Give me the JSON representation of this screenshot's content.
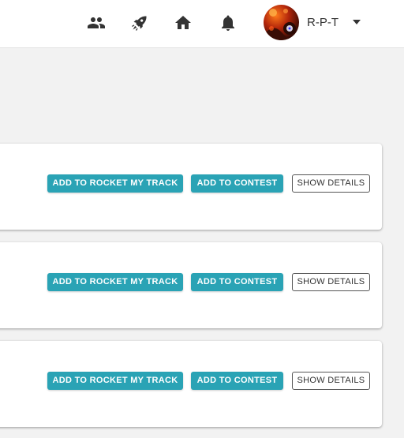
{
  "topbar": {
    "icons": [
      "people-icon",
      "rocket-icon",
      "home-icon",
      "bell-icon"
    ],
    "user": {
      "name": "R-P-T"
    }
  },
  "cards": [
    {
      "rocket_label": "ADD TO ROCKET MY TRACK",
      "contest_label": "ADD TO CONTEST",
      "details_label": "SHOW DETAILS"
    },
    {
      "rocket_label": "ADD TO ROCKET MY TRACK",
      "contest_label": "ADD TO CONTEST",
      "details_label": "SHOW DETAILS"
    },
    {
      "rocket_label": "ADD TO ROCKET MY TRACK",
      "contest_label": "ADD TO CONTEST",
      "details_label": "SHOW DETAILS"
    }
  ],
  "colors": {
    "primary": "#2aa3b5",
    "background": "#f2f2f2",
    "icon": "#333333"
  }
}
